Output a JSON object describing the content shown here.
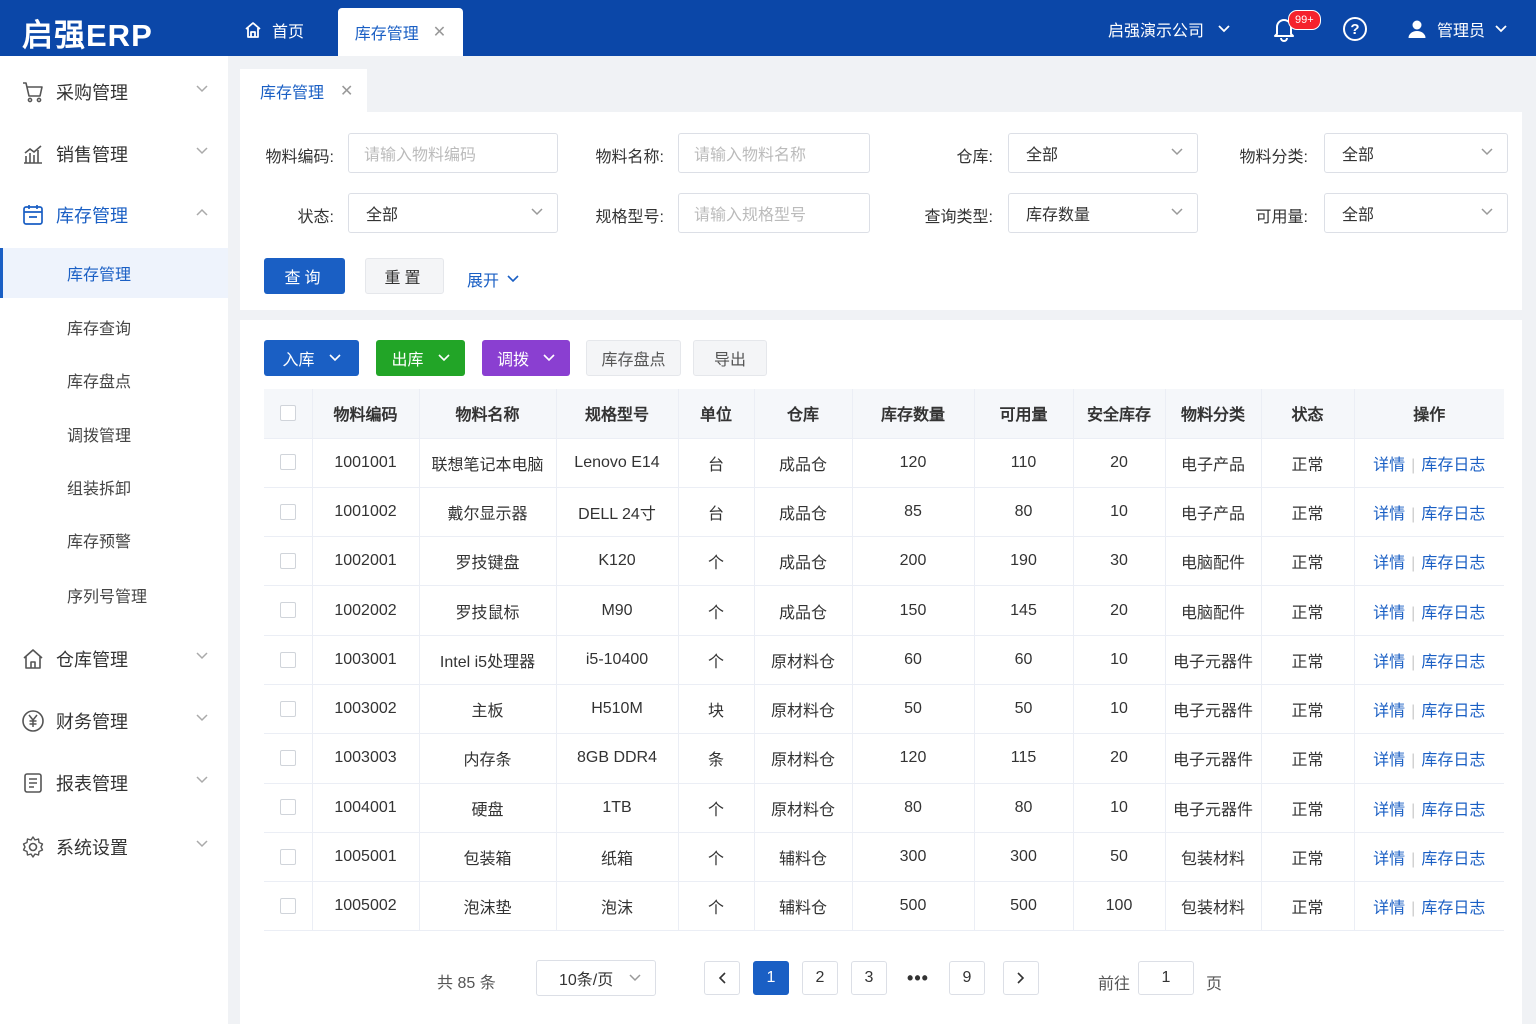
{
  "app": {
    "logo": "启强ERP"
  },
  "topbar": {
    "home_label": "首页",
    "active_tab": "库存管理",
    "company": "启强演示公司",
    "notification_badge": "99+",
    "help_symbol": "?",
    "user": "管理员"
  },
  "sidebar": {
    "menus": [
      {
        "label": "采购管理",
        "icon": "cart-icon"
      },
      {
        "label": "销售管理",
        "icon": "chart-icon"
      },
      {
        "label": "库存管理",
        "icon": "inventory-icon",
        "expanded": true
      },
      {
        "label": "仓库管理",
        "icon": "home-icon"
      },
      {
        "label": "财务管理",
        "icon": "yen-icon"
      },
      {
        "label": "报表管理",
        "icon": "report-icon"
      },
      {
        "label": "系统设置",
        "icon": "gear-icon"
      }
    ],
    "submenu": [
      "库存管理",
      "库存查询",
      "库存盘点",
      "调拨管理",
      "组装拆卸",
      "库存预警",
      "序列号管理"
    ]
  },
  "content_tab": {
    "label": "库存管理"
  },
  "filters": {
    "material_code": {
      "label": "物料编码:",
      "placeholder": "请输入物料编码"
    },
    "material_name": {
      "label": "物料名称:",
      "placeholder": "请输入物料名称"
    },
    "warehouse": {
      "label": "仓库:",
      "value": "全部"
    },
    "category": {
      "label": "物料分类:",
      "value": "全部"
    },
    "status": {
      "label": "状态:",
      "value": "全部"
    },
    "spec": {
      "label": "规格型号:",
      "placeholder": "请输入规格型号"
    },
    "query_type": {
      "label": "查询类型:",
      "value": "库存数量"
    },
    "available": {
      "label": "可用量:",
      "value": "全部"
    },
    "search_label": "查询",
    "reset_label": "重置",
    "expand_label": "展开"
  },
  "actions": {
    "inbound": "入库",
    "outbound": "出库",
    "transfer": "调拨",
    "stocktake": "库存盘点",
    "export": "导出"
  },
  "colors": {
    "primary": "#1a5fc4",
    "inbound": "#1a5fc4",
    "outbound": "#22a527",
    "transfer": "#8a3fd1",
    "header": "#0b47a8"
  },
  "table": {
    "columns": [
      "物料编码",
      "物料名称",
      "规格型号",
      "单位",
      "仓库",
      "库存数量",
      "可用量",
      "安全库存",
      "物料分类",
      "状态",
      "操作"
    ],
    "op_detail": "详情",
    "op_log": "库存日志",
    "rows": [
      [
        "1001001",
        "联想笔记本电脑",
        "Lenovo E14",
        "台",
        "成品仓",
        "120",
        "110",
        "20",
        "电子产品",
        "正常"
      ],
      [
        "1001002",
        "戴尔显示器",
        "DELL 24寸",
        "台",
        "成品仓",
        "85",
        "80",
        "10",
        "电子产品",
        "正常"
      ],
      [
        "1002001",
        "罗技键盘",
        "K120",
        "个",
        "成品仓",
        "200",
        "190",
        "30",
        "电脑配件",
        "正常"
      ],
      [
        "1002002",
        "罗技鼠标",
        "M90",
        "个",
        "成品仓",
        "150",
        "145",
        "20",
        "电脑配件",
        "正常"
      ],
      [
        "1003001",
        "Intel i5处理器",
        "i5-10400",
        "个",
        "原材料仓",
        "60",
        "60",
        "10",
        "电子元器件",
        "正常"
      ],
      [
        "1003002",
        "主板",
        "H510M",
        "块",
        "原材料仓",
        "50",
        "50",
        "10",
        "电子元器件",
        "正常"
      ],
      [
        "1003003",
        "内存条",
        "8GB DDR4",
        "条",
        "原材料仓",
        "120",
        "115",
        "20",
        "电子元器件",
        "正常"
      ],
      [
        "1004001",
        "硬盘",
        "1TB",
        "个",
        "原材料仓",
        "80",
        "80",
        "10",
        "电子元器件",
        "正常"
      ],
      [
        "1005001",
        "包装箱",
        "纸箱",
        "个",
        "辅料仓",
        "300",
        "300",
        "50",
        "包装材料",
        "正常"
      ],
      [
        "1005002",
        "泡沫垫",
        "泡沫",
        "个",
        "辅料仓",
        "500",
        "500",
        "100",
        "包装材料",
        "正常"
      ]
    ]
  },
  "pagination": {
    "total": "共 85 条",
    "page_size": "10条/页",
    "pages": [
      "1",
      "2",
      "3",
      "9"
    ],
    "ellipsis": "•••",
    "current": "1",
    "goto_prefix": "前往",
    "goto_value": "1",
    "goto_suffix": "页"
  }
}
